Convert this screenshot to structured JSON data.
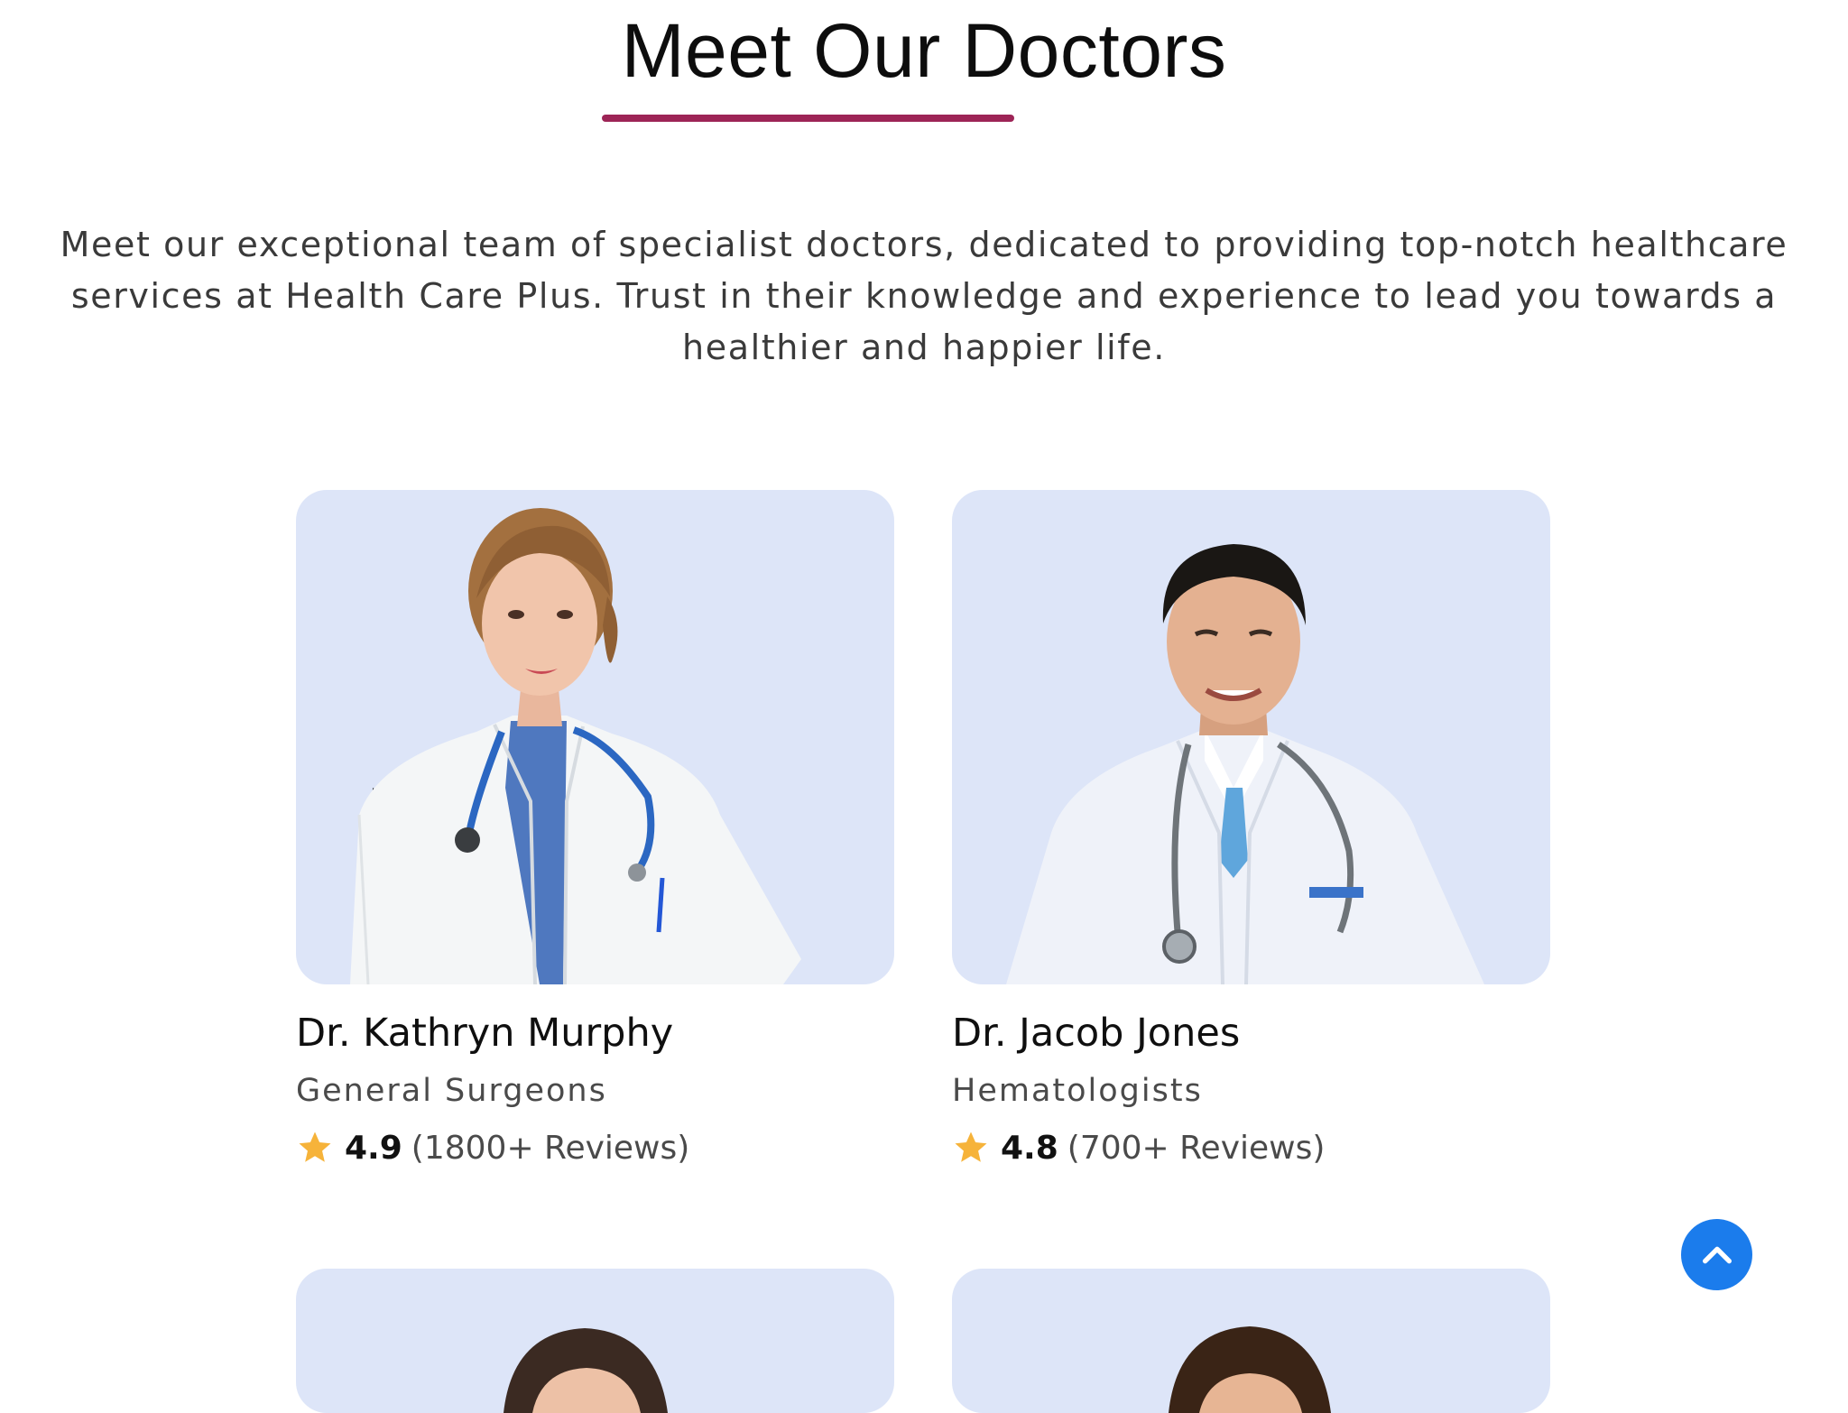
{
  "section": {
    "title": "Meet Our Doctors",
    "intro_lines": [
      "Meet our exceptional team of specialist doctors, dedicated to providing top-notch healthcare",
      "services at Health Care Plus. Trust in their knowledge and experience to lead you towards a",
      "healthier and happier life."
    ]
  },
  "doctors": [
    {
      "name": "Dr. Kathryn Murphy",
      "specialty": "General Surgeons",
      "rating": "4.9",
      "reviews": "(1800+ Reviews)"
    },
    {
      "name": "Dr. Jacob Jones",
      "specialty": "Hematologists",
      "rating": "4.8",
      "reviews": "(700+ Reviews)"
    }
  ],
  "colors": {
    "accent_underline": "#9d2456",
    "card_background": "#dde5f8",
    "star": "#f6b33a",
    "scroll_button": "#1b7cec"
  },
  "icons": {
    "rating": "star-icon",
    "scroll_top": "chevron-up-icon"
  }
}
